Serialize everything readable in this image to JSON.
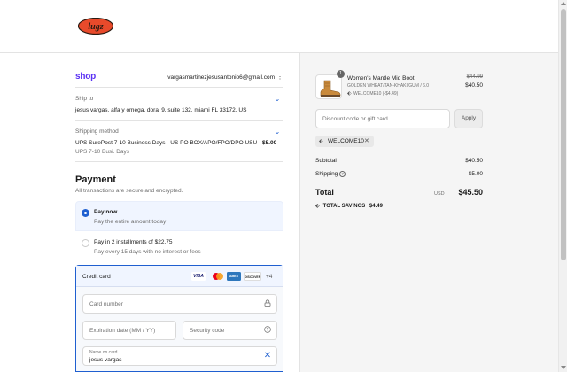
{
  "header": {
    "logo_text": "lugz"
  },
  "account": {
    "shop_brand": "shop",
    "email": "vargasmartinezjesusantonio6@gmail.com",
    "menu_icon": "kebab-icon"
  },
  "review": {
    "ship_to_label": "Ship to",
    "ship_to_value": "jesus vargas, alfa y omega, doral 9, suite 132, miami FL 33172, US",
    "shipping_method_label": "Shipping method",
    "shipping_method_value": "UPS SurePost 7-10 Business Days - US PO BOX/APO/FPO/DPO USU - ",
    "shipping_method_price": "$5.00",
    "shipping_method_sub": "UPS 7-10 Busi. Days"
  },
  "payment": {
    "heading": "Payment",
    "subtitle": "All transactions are secure and encrypted.",
    "options": [
      {
        "title": "Pay now",
        "desc": "Pay the entire amount today",
        "selected": true
      },
      {
        "title": "Pay in 2 installments of $22.75",
        "desc": "Pay every 15 days with no interest or fees",
        "selected": false
      }
    ],
    "credit_card": {
      "title": "Credit card",
      "brands": [
        "VISA",
        "Mastercard",
        "AMEX",
        "DISCOVER"
      ],
      "brands_text": {
        "visa": "VISA",
        "amex": "AMEX",
        "discover": "DISCOVER"
      },
      "more": "+4",
      "card_number_placeholder": "Card number",
      "expiration_placeholder": "Expiration date (MM / YY)",
      "security_code_placeholder": "Security code",
      "name_label": "Name on card",
      "name_value": "jesus vargas"
    }
  },
  "order": {
    "item": {
      "quantity": "1",
      "name": "Women's Mantle Mid Boot",
      "variant": "GOLDEN WHEAT/TAN-KHAKI/GUM / 6.0",
      "discount": "WELCOME10 (-$4.49)",
      "original_price": "$44.99",
      "final_price": "$40.50"
    },
    "discount_placeholder": "Discount code or gift card",
    "apply_label": "Apply",
    "applied_code": "WELCOME10",
    "subtotal_label": "Subtotal",
    "subtotal_value": "$40.50",
    "shipping_label": "Shipping",
    "shipping_value": "$5.00",
    "total_label": "Total",
    "total_currency": "USD",
    "total_value": "$45.50",
    "savings_label": "TOTAL SAVINGS",
    "savings_value": "$4.49"
  },
  "colors": {
    "accent": "#1f5fd0",
    "shop_brand": "#5a31f4",
    "logo_red": "#e84a2b"
  }
}
